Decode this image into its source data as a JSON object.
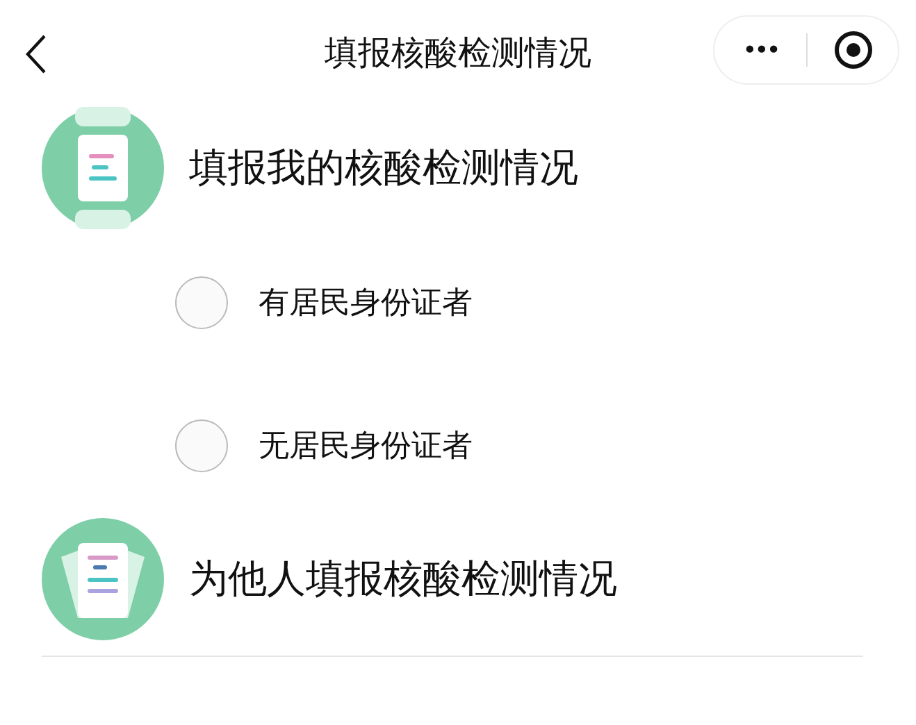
{
  "header": {
    "title": "填报核酸检测情况",
    "menu_glyph": "•••"
  },
  "sections": [
    {
      "kind": "self",
      "title": "填报我的核酸检测情况",
      "options": [
        {
          "label": "有居民身份证者",
          "selected": false
        },
        {
          "label": "无居民身份证者",
          "selected": false
        }
      ]
    },
    {
      "kind": "others",
      "title": "为他人填报核酸检测情况"
    }
  ]
}
